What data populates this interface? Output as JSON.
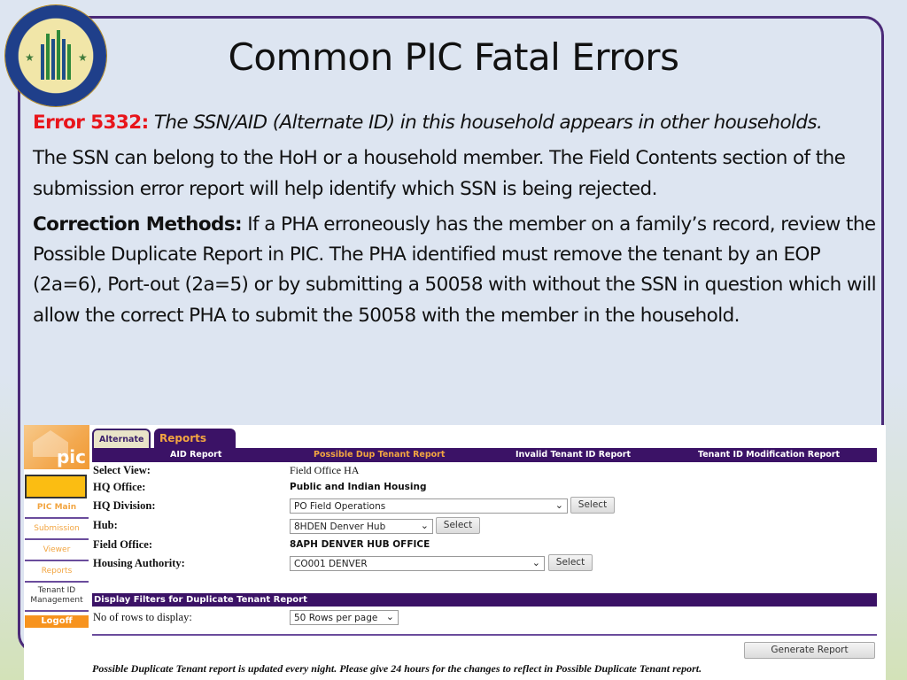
{
  "slide": {
    "title": "Common PIC Fatal Errors",
    "logo_label": "U.S. Department of Housing and Urban Development seal",
    "error": {
      "label": "Error 5332:",
      "description": "The SSN/AID (Alternate ID) in this household appears in other households."
    },
    "paragraph1": "The SSN can belong to the HoH or a household member. The Field Contents section of the submission error report will help identify which SSN is being rejected.",
    "correction": {
      "label": "Correction Methods:",
      "text": "If a PHA erroneously has the member on a family’s record, review the Possible Duplicate Report in PIC. The PHA identified must remove the tenant by an EOP (2a=6), Port-out (2a=5) or by submitting a 50058 with without the SSN in question which will allow the correct PHA to submit the 50058 with the member in the household."
    }
  },
  "pic": {
    "logo_text": "pic",
    "sidebar": [
      {
        "label": "PIC Main",
        "active": true
      },
      {
        "label": "Submission"
      },
      {
        "label": "Viewer"
      },
      {
        "label": "Reports"
      },
      {
        "label": "Tenant ID Management"
      }
    ],
    "logoff": "Logoff",
    "tabs": [
      "Alternate ID",
      "Reports"
    ],
    "subnav": [
      "AID Report",
      "Possible Dup Tenant Report",
      "Invalid Tenant ID Report",
      "Tenant ID Modification Report"
    ],
    "form": {
      "select_view_label": "Select View:",
      "select_view_value": "Field Office HA",
      "hq_office_label": "HQ Office:",
      "hq_office_value": "Public and Indian Housing",
      "hq_division_label": "HQ Division:",
      "hq_division_value": "PO Field Operations",
      "hub_label": "Hub:",
      "hub_value": "8HDEN Denver Hub",
      "field_office_label": "Field Office:",
      "field_office_value": "8APH DENVER HUB OFFICE",
      "housing_authority_label": "Housing Authority:",
      "housing_authority_value": "CO001 DENVER",
      "select_button": "Select"
    },
    "filters": {
      "header": "Display Filters for Duplicate Tenant Report",
      "rows_label": "No of rows to display:",
      "rows_value": "50 Rows per page"
    },
    "generate_button": "Generate Report",
    "footnote": "Possible Duplicate Tenant report is updated every night. Please give 24 hours for the changes to reflect in Possible Duplicate Tenant report."
  }
}
